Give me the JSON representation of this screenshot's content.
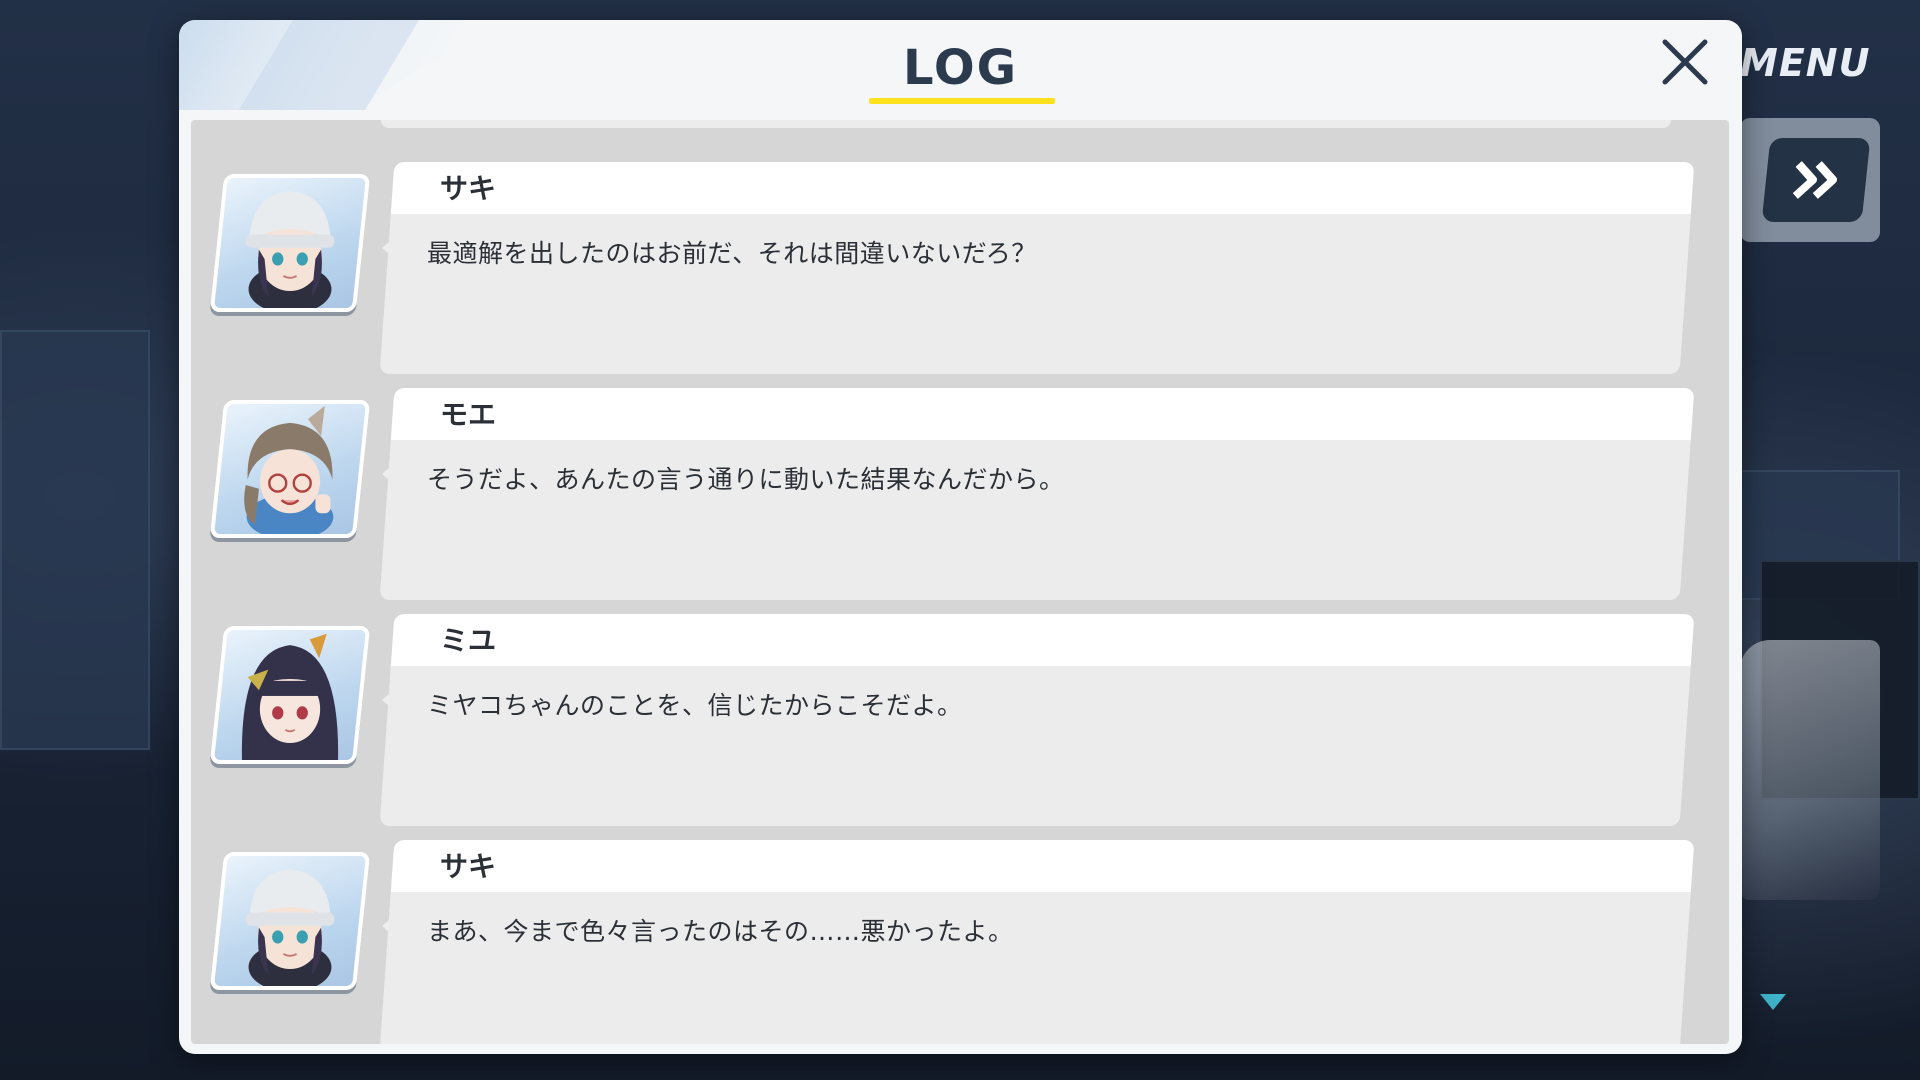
{
  "hud": {
    "menu_label": "MENU"
  },
  "log": {
    "title": "LOG",
    "entries": [
      {
        "speaker": "サキ",
        "text": "最適解を出したのはお前だ、それは間違いないだろ？"
      },
      {
        "speaker": "モエ",
        "text": "そうだよ、あんたの言う通りに動いた結果なんだから。"
      },
      {
        "speaker": "ミユ",
        "text": "ミヤコちゃんのことを、信じたからこそだよ。"
      },
      {
        "speaker": "サキ",
        "text": "まあ、今まで色々言ったのはその……悪かったよ。"
      }
    ]
  },
  "colors": {
    "title_underline": "#ffe11e",
    "title_text": "#2c3a4e",
    "skip_button": "#243246",
    "scroll_arrow": "#3fb2c8"
  },
  "icons": {
    "close": "close-icon",
    "skip": "fast-forward-icon",
    "scroll": "triangle-down-icon"
  }
}
